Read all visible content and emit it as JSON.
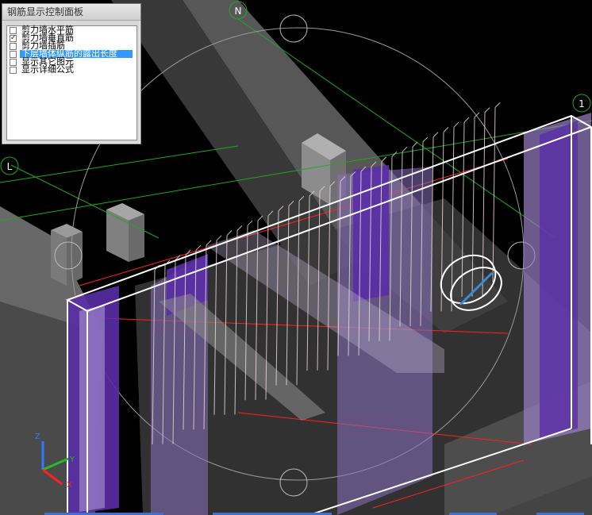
{
  "panel": {
    "title": "钢筋显示控制面板",
    "items": [
      {
        "label": "剪力墙水平筋",
        "checked": false,
        "selected": false
      },
      {
        "label": "剪力墙垂直筋",
        "checked": true,
        "selected": false
      },
      {
        "label": "剪力墙插筋",
        "checked": false,
        "selected": false
      },
      {
        "label": "下层墙体纵筋的露出长度",
        "checked": false,
        "selected": true
      },
      {
        "label": "显示其它图元",
        "checked": false,
        "selected": false
      },
      {
        "label": "显示详细公式",
        "checked": false,
        "selected": false
      }
    ]
  },
  "view": {
    "axis_labels": {
      "north": "N",
      "grid_1": "1",
      "grid_l": "L"
    },
    "triad": {
      "z": "Z",
      "y": "Y",
      "x": "X"
    },
    "colors": {
      "background": "#000000",
      "wall_purple": "#5a2ea6",
      "wall_glass": "#9a80c8",
      "gray_body": "#5a5a5a",
      "rebar": "#e8d8d8",
      "grid_green": "#1fa81f",
      "edge_white": "#ffffff",
      "axis_red": "#ff2020"
    }
  }
}
